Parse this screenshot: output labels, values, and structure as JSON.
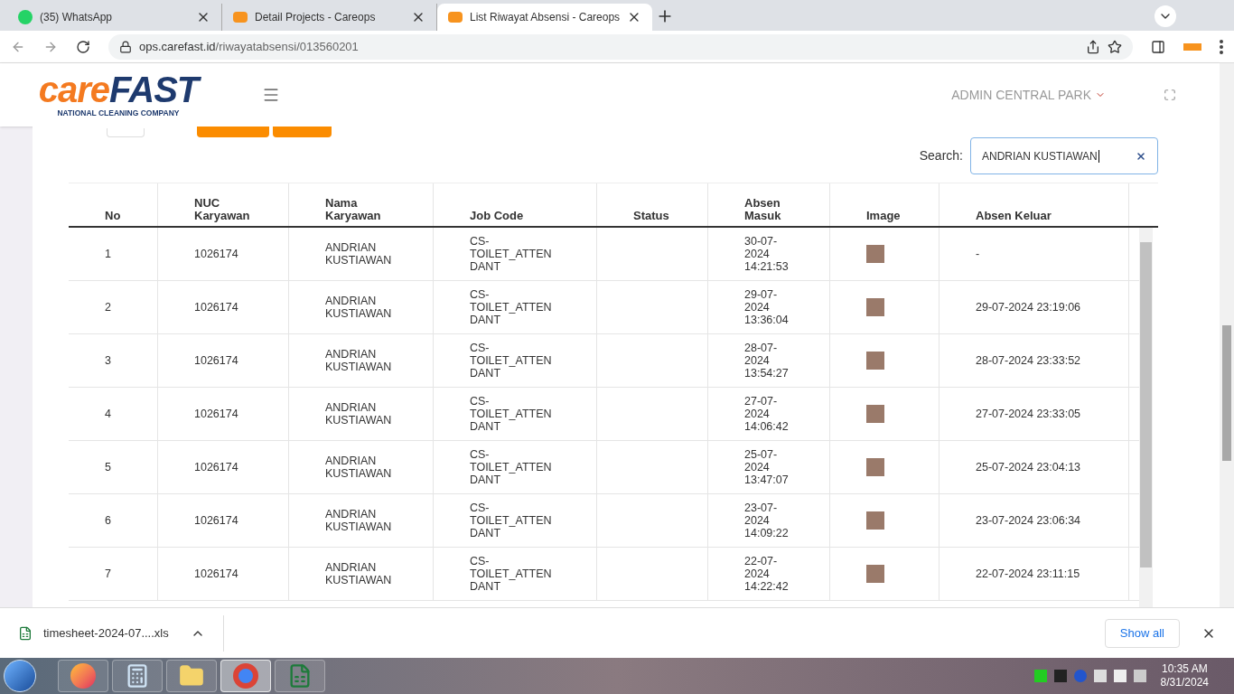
{
  "browser": {
    "tabs": [
      {
        "title": "(35) WhatsApp",
        "kind": "whatsapp",
        "selected": false
      },
      {
        "title": "Detail Projects - Careops",
        "kind": "careops",
        "selected": false
      },
      {
        "title": "List Riwayat Absensi - Careops",
        "kind": "careops",
        "selected": true
      }
    ],
    "url_host": "ops.carefast.id",
    "url_path": "/riwayatabsensi/013560201"
  },
  "header": {
    "logo_main": "care",
    "logo_accent": "FAST",
    "logo_tagline": "NATIONAL CLEANING COMPANY",
    "user": "ADMIN CENTRAL PARK"
  },
  "search": {
    "label": "Search:",
    "value": "ANDRIAN KUSTIAWAN"
  },
  "table": {
    "columns": [
      "No",
      "NUC\nKaryawan",
      "Nama\nKaryawan",
      "Job Code",
      "Status",
      "Absen\nMasuk",
      "Image",
      "Absen Keluar"
    ],
    "rows": [
      {
        "no": "1",
        "nuc": "1026174",
        "nama": "ANDRIAN\nKUSTIAWAN",
        "job": "CS-\nTOILET_ATTEN\nDANT",
        "masuk": "30-07-\n2024\n14:21:53",
        "keluar": "-"
      },
      {
        "no": "2",
        "nuc": "1026174",
        "nama": "ANDRIAN\nKUSTIAWAN",
        "job": "CS-\nTOILET_ATTEN\nDANT",
        "masuk": "29-07-\n2024\n13:36:04",
        "keluar": "29-07-2024 23:19:06"
      },
      {
        "no": "3",
        "nuc": "1026174",
        "nama": "ANDRIAN\nKUSTIAWAN",
        "job": "CS-\nTOILET_ATTEN\nDANT",
        "masuk": "28-07-\n2024\n13:54:27",
        "keluar": "28-07-2024 23:33:52"
      },
      {
        "no": "4",
        "nuc": "1026174",
        "nama": "ANDRIAN\nKUSTIAWAN",
        "job": "CS-\nTOILET_ATTEN\nDANT",
        "masuk": "27-07-\n2024\n14:06:42",
        "keluar": "27-07-2024 23:33:05"
      },
      {
        "no": "5",
        "nuc": "1026174",
        "nama": "ANDRIAN\nKUSTIAWAN",
        "job": "CS-\nTOILET_ATTEN\nDANT",
        "masuk": "25-07-\n2024\n13:47:07",
        "keluar": "25-07-2024 23:04:13"
      },
      {
        "no": "6",
        "nuc": "1026174",
        "nama": "ANDRIAN\nKUSTIAWAN",
        "job": "CS-\nTOILET_ATTEN\nDANT",
        "masuk": "23-07-\n2024\n14:09:22",
        "keluar": "23-07-2024 23:06:34"
      },
      {
        "no": "7",
        "nuc": "1026174",
        "nama": "ANDRIAN\nKUSTIAWAN",
        "job": "CS-\nTOILET_ATTEN\nDANT",
        "masuk": "22-07-\n2024\n14:22:42",
        "keluar": "22-07-2024 23:11:15"
      }
    ]
  },
  "download": {
    "file": "timesheet-2024-07....xls",
    "show_all": "Show all"
  },
  "taskbar": {
    "apps": [
      {
        "kind": "firefox",
        "selected": false
      },
      {
        "kind": "calculator",
        "selected": false
      },
      {
        "kind": "folder",
        "selected": false
      },
      {
        "kind": "chrome",
        "selected": true
      },
      {
        "kind": "excel",
        "selected": false
      }
    ],
    "time": "10:35 AM",
    "date": "8/31/2024"
  }
}
